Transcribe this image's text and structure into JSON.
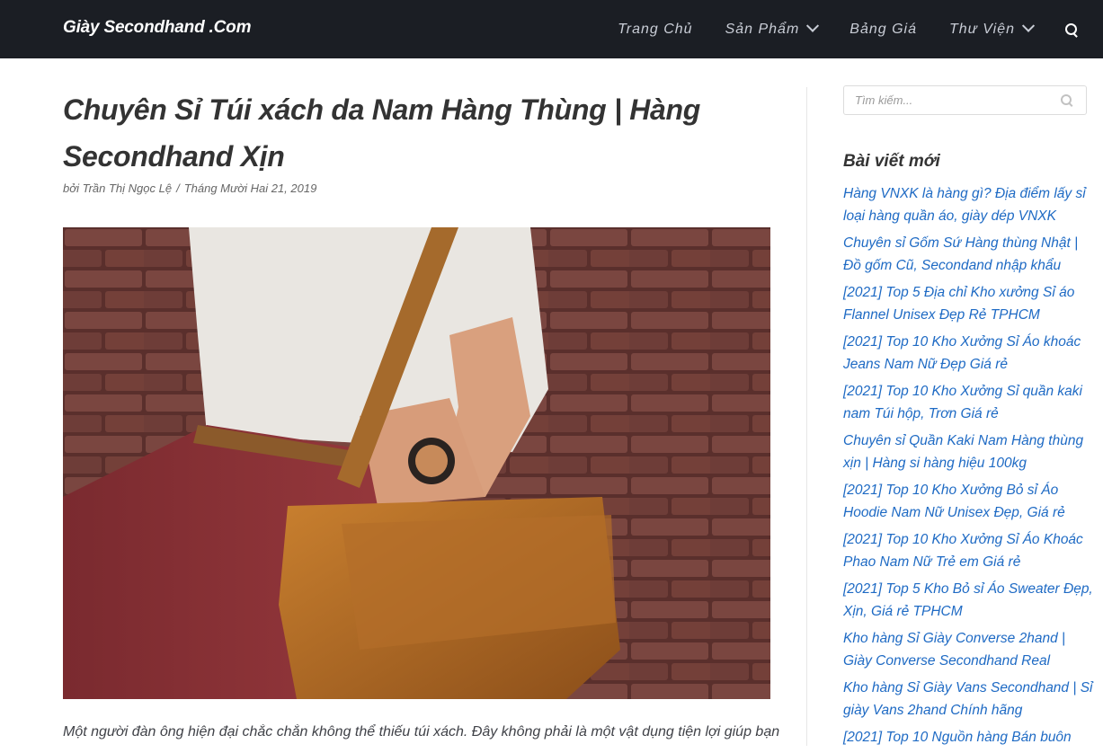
{
  "header": {
    "brand": "Giày Secondhand .Com",
    "nav": [
      {
        "label": "Trang Chủ",
        "has_dropdown": false
      },
      {
        "label": "Sản Phẩm",
        "has_dropdown": true
      },
      {
        "label": "Bảng Giá",
        "has_dropdown": false
      },
      {
        "label": "Thư Viện",
        "has_dropdown": true
      }
    ],
    "search_icon": "search-icon"
  },
  "article": {
    "title": "Chuyên Sỉ Túi xách da Nam Hàng Thùng | Hàng Secondhand Xịn",
    "author_prefix": "bởi",
    "author": "Trần Thị Ngọc Lệ",
    "separator": "/",
    "date": "Tháng Mười Hai 21, 2019",
    "excerpt": "Một người đàn ông hiện đại chắc chắn không thể thiếu túi xách. Đây không phải là một vật dụng tiện lợi giúp bạn"
  },
  "sidebar": {
    "search_placeholder": "Tìm kiếm...",
    "widget_title": "Bài viết mới",
    "posts": [
      "Hàng VNXK là hàng gì? Địa điểm lấy sỉ loại hàng quần áo, giày dép VNXK",
      "Chuyên sỉ Gốm Sứ Hàng thùng Nhật | Đồ gốm Cũ, Secondand nhập khẩu",
      "[2021] Top 5 Địa chỉ Kho xưởng Sỉ áo Flannel Unisex Đẹp Rẻ TPHCM",
      "[2021] Top 10 Kho Xưởng Sỉ Áo khoác Jeans Nam Nữ Đẹp Giá rẻ",
      "[2021] Top 10 Kho Xưởng Sỉ quần kaki nam Túi hộp, Trơn Giá rẻ",
      "Chuyên sỉ Quần Kaki Nam Hàng thùng xịn | Hàng si hàng hiệu 100kg",
      "[2021] Top 10 Kho Xưởng Bỏ sỉ Áo Hoodie Nam Nữ Unisex Đẹp, Giá rẻ",
      "[2021] Top 10 Kho Xưởng Sỉ Áo Khoác Phao Nam Nữ Trẻ em Giá rẻ",
      "[2021] Top 5 Kho Bỏ sỉ Áo Sweater Đẹp, Xịn, Giá rẻ TPHCM",
      "Kho hàng Sỉ Giày Converse 2hand | Giày Converse Secondhand Real",
      "Kho hàng Sỉ Giày Vans Secondhand | Sỉ giày Vans 2hand Chính hãng",
      "[2021] Top 10 Nguồn hàng Bán buôn"
    ]
  },
  "colors": {
    "header_bg": "#1b1e24",
    "link": "#1e6ac4"
  }
}
